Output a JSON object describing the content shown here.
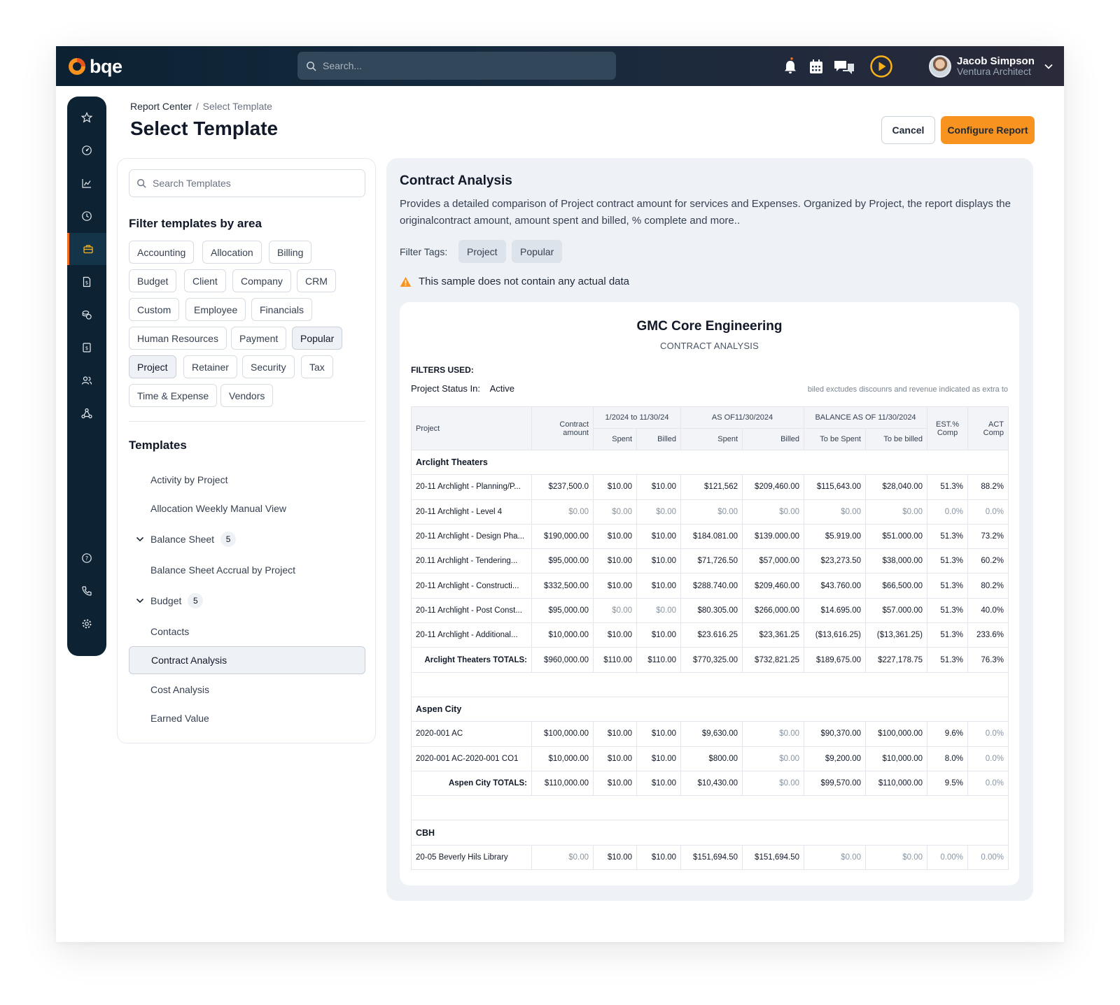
{
  "topbar": {
    "brand": "bqe",
    "search_placeholder": "Search...",
    "user_name": "Jacob Simpson",
    "user_org": "Ventura Architect"
  },
  "header": {
    "breadcrumb_root": "Report Center",
    "breadcrumb_sep": "/",
    "breadcrumb_current": "Select Template",
    "title": "Select Template",
    "cancel_label": "Cancel",
    "configure_label": "Configure Report"
  },
  "filters": {
    "search_placeholder": "Search Templates",
    "title": "Filter templates by area",
    "chips": [
      {
        "label": "Accounting",
        "selected": false
      },
      {
        "label": "Allocation",
        "selected": false
      },
      {
        "label": "Billing",
        "selected": false
      },
      {
        "label": "Budget",
        "selected": false
      },
      {
        "label": "Client",
        "selected": false
      },
      {
        "label": "Company",
        "selected": false
      },
      {
        "label": "CRM",
        "selected": false
      },
      {
        "label": "Custom",
        "selected": false
      },
      {
        "label": "Employee",
        "selected": false
      },
      {
        "label": "Financials",
        "selected": false
      },
      {
        "label": "Human Resources",
        "selected": false
      },
      {
        "label": "Payment",
        "selected": false
      },
      {
        "label": "Popular",
        "selected": true
      },
      {
        "label": "Project",
        "selected": true
      },
      {
        "label": "Retainer",
        "selected": false
      },
      {
        "label": "Security",
        "selected": false
      },
      {
        "label": "Tax",
        "selected": false
      },
      {
        "label": "Time & Expense",
        "selected": false
      },
      {
        "label": "Vendors",
        "selected": false
      }
    ]
  },
  "templates": {
    "title": "Templates",
    "items": [
      {
        "label": "Activity by Project"
      },
      {
        "label": "Allocation Weekly Manual View"
      },
      {
        "label": "Balance Sheet",
        "count": "5",
        "expandable": true
      },
      {
        "label": "Balance Sheet Accrual by Project"
      },
      {
        "label": "Budget",
        "count": "5",
        "expandable": true
      },
      {
        "label": "Contacts"
      },
      {
        "label": "Contract Analysis",
        "selected": true
      },
      {
        "label": "Cost Analysis"
      },
      {
        "label": "Earned Value"
      }
    ]
  },
  "preview": {
    "title": "Contract Analysis",
    "description": "Provides a detailed comparison of Project contract amount for services and Expenses. Organized by Project, the report displays the originalcontract amount, amount spent and billed, % complete and more..",
    "tags_label": "Filter Tags:",
    "tags": [
      "Project",
      "Popular"
    ],
    "warning": "This sample does not contain any actual data"
  },
  "report": {
    "company": "GMC Core Engineering",
    "subtitle": "CONTRACT ANALYSIS",
    "filters_label": "FILTERS USED:",
    "status_label": "Project Status In:",
    "status_value": "Active",
    "note": "biled exctudes discounrs and revenue indicated as extra to",
    "header": {
      "project": "Project",
      "contract": "Contract amount",
      "period": "1/2024 to 11/30/24",
      "asof": "AS OF11/30/2024",
      "balance": "BALANCE AS OF 11/30/2024",
      "est": "EST.% Comp",
      "act": "ACT Comp",
      "spent": "Spent",
      "billed": "Billed",
      "to_spent": "To be Spent",
      "to_billed": "To be billed"
    },
    "groups": [
      {
        "name": "Arclight Theaters",
        "rows": [
          [
            "20-11 Archlight - Planning/P...",
            "$237,500.0",
            "$10.00",
            "$10.00",
            "$121,562",
            "$209,460.00",
            "$115,643.00",
            "$28,040.00",
            "51.3%",
            "88.2%"
          ],
          [
            "20-11 Archlight - Level 4",
            "$0.00",
            "$0.00",
            "$0.00",
            "$0.00",
            "$0.00",
            "$0.00",
            "$0.00",
            "0.0%",
            "0.0%"
          ],
          [
            "20-11 Archlight - Design Pha...",
            "$190,000.00",
            "$10.00",
            "$10.00",
            "$184.081.00",
            "$139.000.00",
            "$5.919.00",
            "$51.000.00",
            "51.3%",
            "73.2%"
          ],
          [
            "20.11 Archlight - Tendering...",
            "$95,000.00",
            "$10.00",
            "$10.00",
            "$71,726.50",
            "$57,000.00",
            "$23,273.50",
            "$38,000.00",
            "51.3%",
            "60.2%"
          ],
          [
            "20-11 Archlight - Constructi...",
            "$332,500.00",
            "$10.00",
            "$10.00",
            "$288.740.00",
            "$209,460.00",
            "$43.760.00",
            "$66,500.00",
            "51.3%",
            "80.2%"
          ],
          [
            "20-11 Archlight - Post Const...",
            "$95,000.00",
            "$0.00",
            "$0.00",
            "$80.305.00",
            "$266,000.00",
            "$14.695.00",
            "$57.000.00",
            "51.3%",
            "40.0%"
          ],
          [
            "20-11 Archlight - Additional...",
            "$10,000.00",
            "$10.00",
            "$10.00",
            "$23.616.25",
            "$23,361.25",
            "($13,616.25)",
            "($13,361.25)",
            "51.3%",
            "233.6%"
          ]
        ],
        "total": [
          "Arclight Theaters TOTALS:",
          "$960,000.00",
          "$110.00",
          "$110.00",
          "$770,325.00",
          "$732,821.25",
          "$189,675.00",
          "$227,178.75",
          "51.3%",
          "76.3%"
        ]
      },
      {
        "name": "Aspen City",
        "rows": [
          [
            "2020-001 AC",
            "$100,000.00",
            "$10.00",
            "$10.00",
            "$9,630.00",
            "$0.00",
            "$90,370.00",
            "$100,000.00",
            "9.6%",
            "0.0%"
          ],
          [
            "2020-001 AC-2020-001 CO1",
            "$10,000.00",
            "$10.00",
            "$10.00",
            "$800.00",
            "$0.00",
            "$9,200.00",
            "$10,000.00",
            "8.0%",
            "0.0%"
          ]
        ],
        "total": [
          "Aspen City TOTALS:",
          "$110,000.00",
          "$10.00",
          "$10.00",
          "$10,430.00",
          "$0.00",
          "$99,570.00",
          "$110,000.00",
          "9.5%",
          "0.0%"
        ]
      },
      {
        "name": "CBH",
        "rows": [
          [
            "20-05 Beverly Hils Library",
            "$0.00",
            "$10.00",
            "$10.00",
            "$151,694.50",
            "$151,694.50",
            "$0.00",
            "$0.00",
            "0.00%",
            "0.00%"
          ]
        ]
      }
    ]
  },
  "colors": {
    "accent": "#f7931e",
    "nav_bg": "#0d2333",
    "warning": "#f7931e"
  }
}
